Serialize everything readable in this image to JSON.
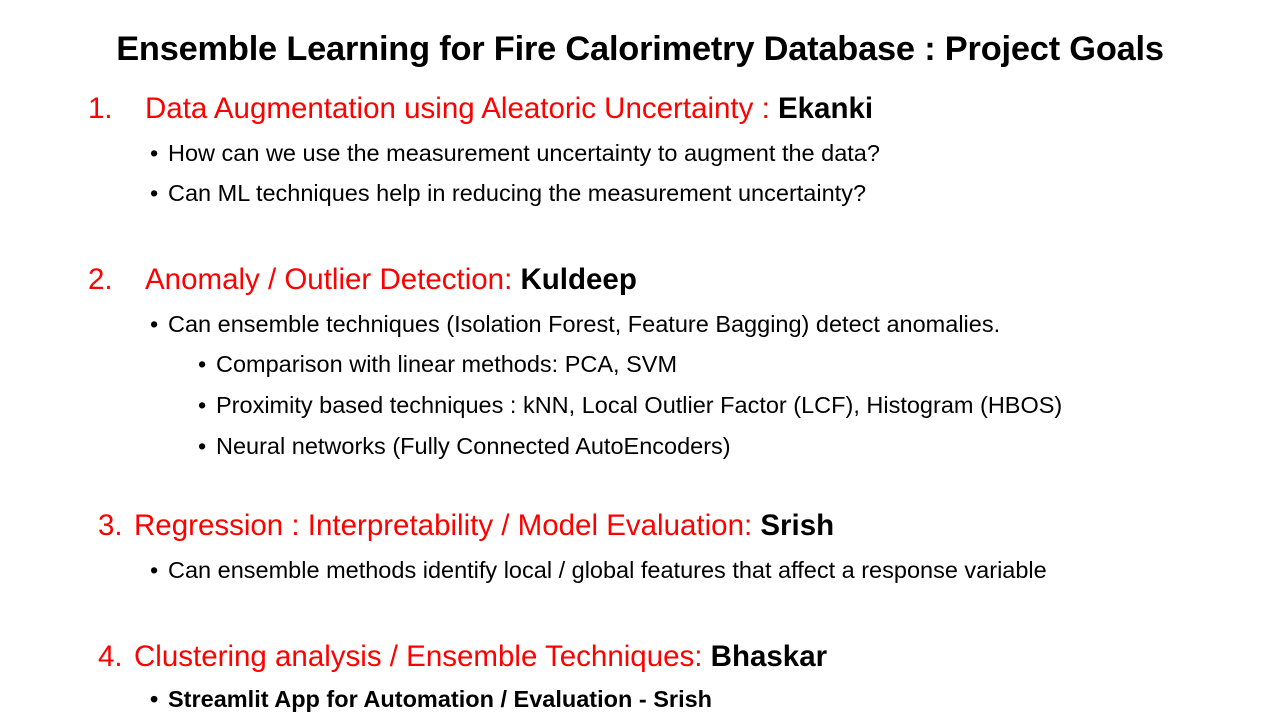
{
  "title": "Ensemble Learning for Fire Calorimetry Database : Project Goals",
  "colors": {
    "goal_text": "#FF0000",
    "owner_text": "#000000",
    "body_text": "#000000",
    "background": "#FFFFFF"
  },
  "goals": [
    {
      "number": "1.",
      "text": "Data Augmentation using Aleatoric Uncertainty : ",
      "owner": "Ekanki",
      "bullets": [
        "How can we use the measurement uncertainty to augment the data?",
        "Can ML techniques help in reducing the measurement uncertainty?"
      ]
    },
    {
      "number": "2.",
      "text": "Anomaly / Outlier Detection: ",
      "owner": "Kuldeep",
      "bullets": [
        "Can ensemble techniques (Isolation Forest, Feature Bagging) detect anomalies."
      ],
      "sub_bullets": [
        "Comparison with linear methods: PCA, SVM",
        "Proximity based techniques : kNN, Local Outlier Factor (LCF), Histogram (HBOS)",
        "Neural networks (Fully Connected AutoEncoders)"
      ]
    },
    {
      "number": "3.",
      "text": "Regression : Interpretability / Model Evaluation: ",
      "owner": "Srish",
      "bullets": [
        "Can ensemble methods identify local / global features that affect a response variable"
      ]
    },
    {
      "number": "4.",
      "text": "Clustering analysis / Ensemble Techniques: ",
      "owner": "Bhaskar",
      "bullets": [
        "Streamlit App for Automation / Evaluation - Srish"
      ]
    }
  ]
}
